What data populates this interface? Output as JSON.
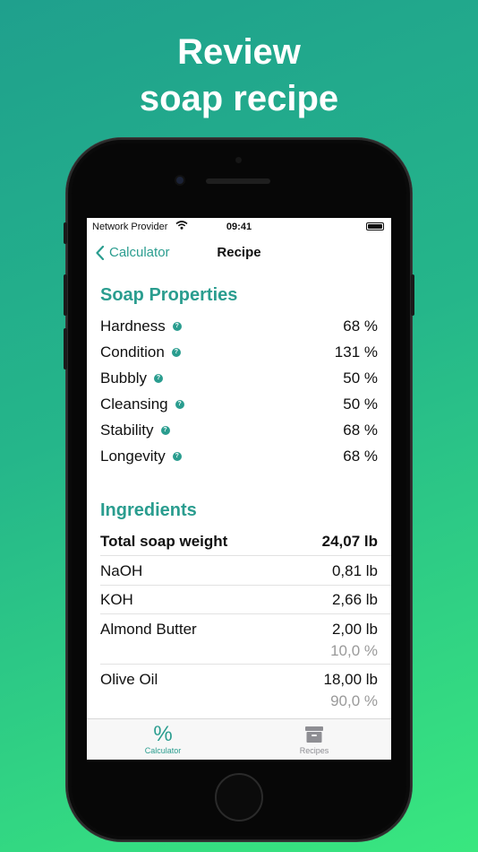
{
  "headline": {
    "line1": "Review",
    "line2": "soap recipe"
  },
  "status_bar": {
    "carrier": "Network Provider",
    "time": "09:41"
  },
  "nav": {
    "back_label": "Calculator",
    "title": "Recipe"
  },
  "soap_properties": {
    "title": "Soap Properties",
    "help_glyph": "?",
    "rows": [
      {
        "name": "Hardness",
        "value": "68 %"
      },
      {
        "name": "Condition",
        "value": "131 %"
      },
      {
        "name": "Bubbly",
        "value": "50 %"
      },
      {
        "name": "Cleansing",
        "value": "50 %"
      },
      {
        "name": "Stability",
        "value": "68 %"
      },
      {
        "name": "Longevity",
        "value": "68 %"
      }
    ]
  },
  "ingredients": {
    "title": "Ingredients",
    "total": {
      "name": "Total soap weight",
      "value": "24,07 lb"
    },
    "rows": [
      {
        "name": "NaOH",
        "value": "0,81 lb"
      },
      {
        "name": "KOH",
        "value": "2,66 lb"
      },
      {
        "name": "Almond Butter",
        "value": "2,00 lb",
        "percent": "10,0 %"
      },
      {
        "name": "Olive Oil",
        "value": "18,00 lb",
        "percent": "90,0 %"
      }
    ]
  },
  "tabbar": {
    "tabs": [
      {
        "label": "Calculator",
        "icon": "percent-icon",
        "glyph": "%",
        "active": true
      },
      {
        "label": "Recipes",
        "icon": "archive-box-icon",
        "active": false
      }
    ]
  },
  "colors": {
    "accent": "#2a9d8f",
    "secondary_text": "#9a9a9a"
  }
}
